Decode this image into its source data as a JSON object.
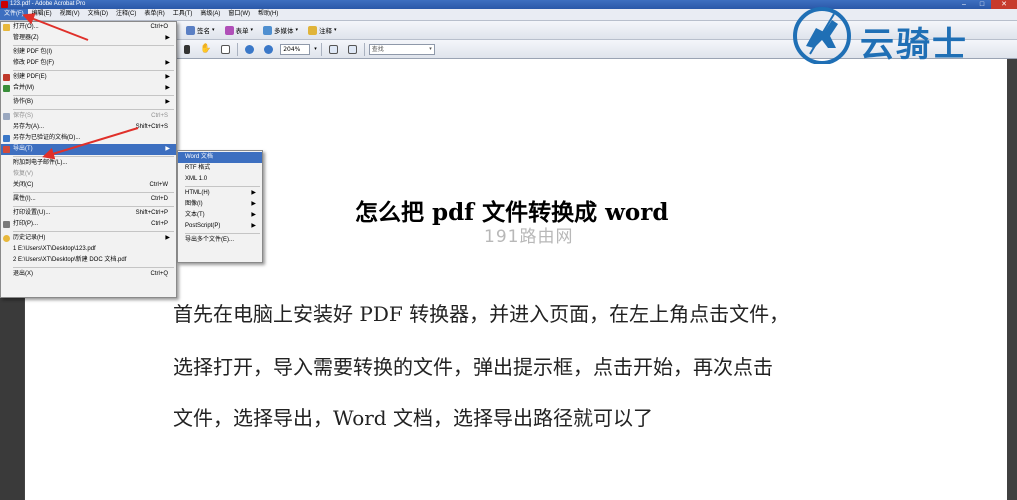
{
  "window": {
    "title": "123.pdf - Adobe Acrobat Pro",
    "controls": {
      "minimize": "–",
      "maximize": "□",
      "close": "✕"
    }
  },
  "menubar": {
    "items": [
      "文件(F)",
      "编辑(E)",
      "视图(V)",
      "文档(D)",
      "注释(C)",
      "表单(R)",
      "工具(T)",
      "高级(A)",
      "窗口(W)",
      "帮助(H)"
    ]
  },
  "toolbar1": {
    "sign": "签名",
    "forms": "表单",
    "multimedia": "多媒体",
    "comment": "注释"
  },
  "toolbar2": {
    "zoom_value": "204%",
    "find_placeholder": "查找"
  },
  "file_menu": {
    "items": [
      {
        "label": "打开(O)...",
        "shortcut": "Ctrl+O"
      },
      {
        "label": "管理器(Z)"
      },
      {
        "label": "创建 PDF 包(I)"
      },
      {
        "label": "修改 PDF 包(F)"
      },
      {
        "label": "创建 PDF(E)"
      },
      {
        "label": "合并(M)"
      },
      {
        "label": "协作(B)"
      },
      {
        "label": "保存(S)",
        "shortcut": "Ctrl+S"
      },
      {
        "label": "另存为(A)...",
        "shortcut": "Shift+Ctrl+S"
      },
      {
        "label": "另存为已验证的文档(D)..."
      },
      {
        "label": "导出(T)"
      },
      {
        "label": "附加到电子邮件(L)..."
      },
      {
        "label": "恢复(V)"
      },
      {
        "label": "关闭(C)",
        "shortcut": "Ctrl+W"
      },
      {
        "label": "属性(I)...",
        "shortcut": "Ctrl+D"
      },
      {
        "label": "打印设置(U)...",
        "shortcut": "Shift+Ctrl+P"
      },
      {
        "label": "打印(P)...",
        "shortcut": "Ctrl+P"
      },
      {
        "label": "历史记录(H)"
      },
      {
        "label": "1 E:\\Users\\XT\\Desktop\\123.pdf"
      },
      {
        "label": "2 E:\\Users\\XT\\Desktop\\新建 DOC 文档.pdf"
      },
      {
        "label": "退出(X)",
        "shortcut": "Ctrl+Q"
      }
    ]
  },
  "export_menu": {
    "items": [
      {
        "label": "Word 文档"
      },
      {
        "label": "RTF 格式"
      },
      {
        "label": "XML 1.0"
      },
      {
        "label": "HTML(H)"
      },
      {
        "label": "图像(I)"
      },
      {
        "label": "文本(T)"
      },
      {
        "label": "PostScript(P)"
      },
      {
        "label": "导出多个文件(E)..."
      }
    ]
  },
  "document": {
    "title": "怎么把 pdf 文件转换成 word",
    "watermark": "191路由网",
    "lines": [
      "首先在电脑上安装好 PDF 转换器，并进入页面，在左上角点击文件，",
      "选择打开，导入需要转换的文件，弹出提示框，点击开始，再次点击",
      "文件，选择导出，Word 文档，选择导出路径就可以了"
    ]
  },
  "logo": {
    "text": "云骑士"
  },
  "colors": {
    "accent": "#3d6fc0",
    "arrow_red": "#e0302a",
    "logo_blue": "#1f6fb5"
  }
}
